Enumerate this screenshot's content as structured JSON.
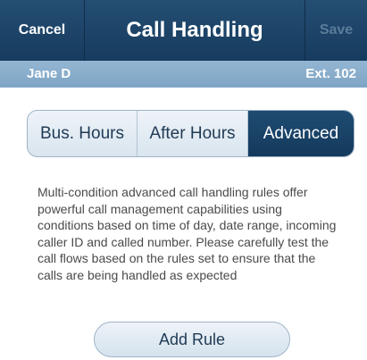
{
  "navbar": {
    "cancel_label": "Cancel",
    "title": "Call Handling",
    "save_label": "Save"
  },
  "user": {
    "name": "Jane D",
    "extension": "Ext. 102"
  },
  "tabs": {
    "items": [
      {
        "label": "Bus. Hours",
        "selected": false
      },
      {
        "label": "After Hours",
        "selected": false
      },
      {
        "label": "Advanced",
        "selected": true
      }
    ]
  },
  "description": "Multi-condition advanced call handling rules offer powerful call management capabilities using conditions based on time of day, date range, incoming caller ID and called number. Please carefully test the call flows based on the rules set to ensure that the calls are being handled as expected",
  "actions": {
    "add_rule_label": "Add Rule"
  },
  "colors": {
    "navbar": "#1b4468",
    "userbar": "#89aecb",
    "selected_tab": "#183f62",
    "save_disabled": "#5a7c99"
  }
}
